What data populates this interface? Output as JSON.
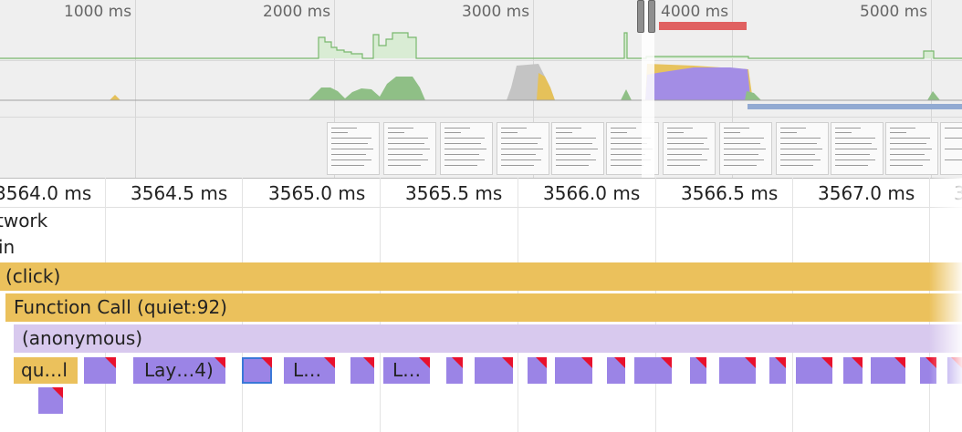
{
  "overview": {
    "time_labels": [
      "1000 ms",
      "2000 ms",
      "3000 ms",
      "4000 ms",
      "5000 ms"
    ],
    "colors": {
      "scripting": "#e8c35c",
      "rendering": "#a28de6",
      "painting": "#86bb80",
      "idle": "#c3c3c3",
      "network_bar": "#e06060",
      "network_bar_2": "#92aad2"
    }
  },
  "ruler": {
    "labels": [
      "3564.0 ms",
      "3564.5 ms",
      "3565.0 ms",
      "3565.5 ms",
      "3566.0 ms",
      "3566.5 ms",
      "3567.0 ms",
      "3"
    ]
  },
  "tracks": {
    "network": "twork",
    "main": "in"
  },
  "flame": {
    "event_click": "(click)",
    "function_call": "Function Call (quiet:92)",
    "anonymous": "(anonymous)",
    "small_labels": {
      "quiet": "qu…l",
      "layout_a": "Lay…4)",
      "layout_b": "L…",
      "layout_c": "L…"
    },
    "colors": {
      "scripting": "#ebc15c",
      "anonymous": "#d8c9ee",
      "rendering": "#9b84e6",
      "marker": "#e8112d"
    }
  }
}
